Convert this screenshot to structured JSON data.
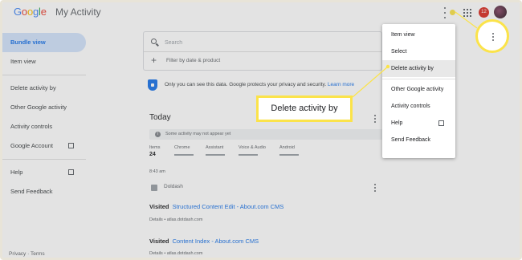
{
  "header": {
    "logo_letters": [
      {
        "ch": "G",
        "color": "#4285f4"
      },
      {
        "ch": "o",
        "color": "#ea4335"
      },
      {
        "ch": "o",
        "color": "#fbbc05"
      },
      {
        "ch": "g",
        "color": "#4285f4"
      },
      {
        "ch": "l",
        "color": "#34a853"
      },
      {
        "ch": "e",
        "color": "#ea4335"
      }
    ],
    "app_title": "My Activity",
    "notification_count": "12",
    "icons": [
      "more-vert-icon",
      "apps-grid-icon",
      "avatar"
    ]
  },
  "sidebar": {
    "items": [
      {
        "label": "Bundle view",
        "active": true
      },
      {
        "label": "Item view"
      },
      {
        "label": "Delete activity by"
      },
      {
        "label": "Other Google activity"
      },
      {
        "label": "Activity controls"
      },
      {
        "label": "Google Account",
        "external": true
      },
      {
        "label": "Help",
        "external": true
      },
      {
        "label": "Send Feedback"
      }
    ],
    "footer": "Privacy · Terms"
  },
  "search": {
    "placeholder": "Search",
    "filter_label": "Filter by date & product"
  },
  "privacy": {
    "text": "Only you can see this data. Google protects your privacy and security.",
    "link": "Learn more"
  },
  "today": {
    "title": "Today",
    "notice": "Some activity may not appear yet",
    "stats": [
      {
        "label": "Items",
        "value": "24"
      },
      {
        "label": "Chrome"
      },
      {
        "label": "Assistant"
      },
      {
        "label": "Voice & Audio"
      },
      {
        "label": "Android"
      }
    ],
    "time": "8:43 am",
    "source": "Doldash"
  },
  "activities": [
    {
      "prefix": "Visited",
      "title": "Structured Content Edit - About.com CMS",
      "details": "Details • atlas.dotdash.com"
    },
    {
      "prefix": "Visited",
      "title": "Content Index - About.com CMS",
      "details": "Details • atlas.dotdash.com"
    }
  ],
  "menu": {
    "items": [
      {
        "label": "Item view"
      },
      {
        "label": "Select"
      },
      {
        "label": "Delete activity by",
        "highlighted": true
      },
      {
        "label": "Other Google activity"
      },
      {
        "label": "Activity controls"
      },
      {
        "label": "Help",
        "external": true
      },
      {
        "label": "Send Feedback"
      }
    ]
  },
  "callout": {
    "label": "Delete activity by",
    "color": "#fbe34a"
  },
  "colors": {
    "accent": "#1a73e8",
    "active_bg": "#d2e3fc",
    "badge": "#d93025",
    "highlight": "#fbe34a"
  }
}
